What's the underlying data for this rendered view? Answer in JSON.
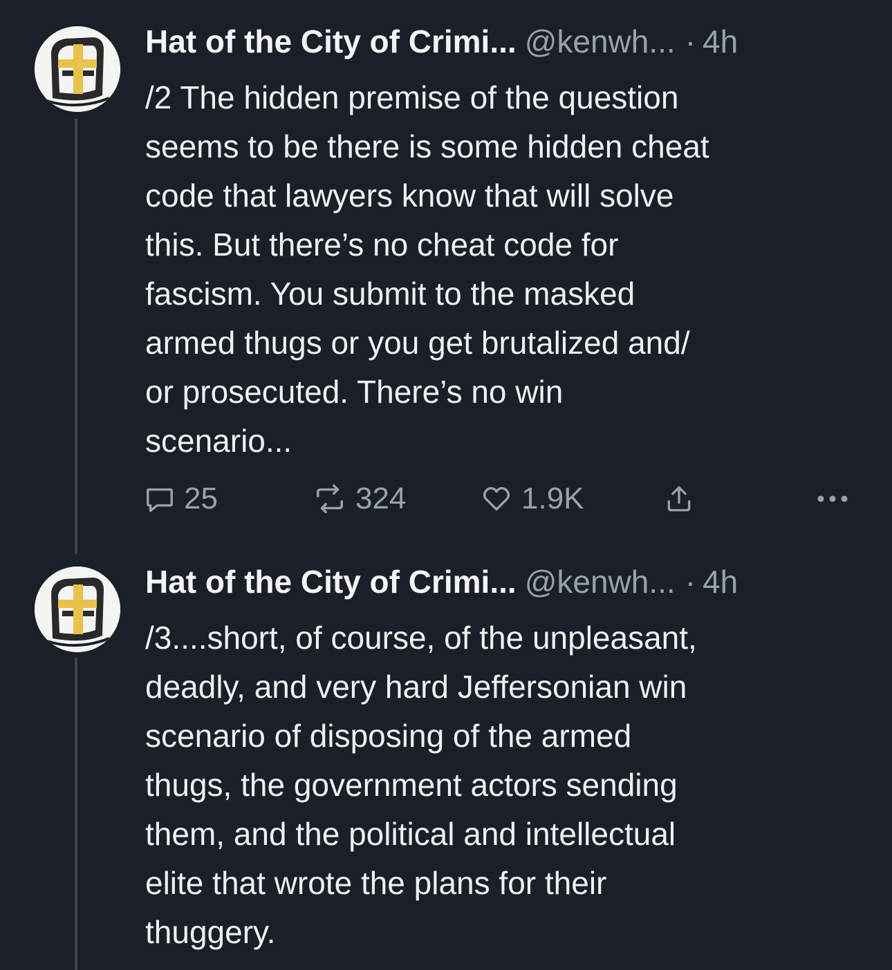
{
  "tweets": [
    {
      "author_name": "Hat of the City of Crimi...",
      "handle": "@kenwh...",
      "separator": "·",
      "time": "4h",
      "avatar_icon": "crusader-helmet-icon",
      "text_lines": [
        "/2 The hidden premise of the question",
        "seems to be there is some hidden cheat",
        "code that lawyers know that will solve",
        "this.  But there’s no cheat code for",
        "fascism.  You submit to the masked",
        "armed thugs or you get brutalized and/",
        "or prosecuted. There’s no win",
        "scenario..."
      ],
      "replies": "25",
      "reposts": "324",
      "likes": "1.9K"
    },
    {
      "author_name": "Hat of the City of Crimi...",
      "handle": "@kenwh...",
      "separator": "·",
      "time": "4h",
      "avatar_icon": "crusader-helmet-icon",
      "text_lines": [
        "/3....short, of course, of the unpleasant,",
        "deadly, and very hard Jeffersonian win",
        "scenario of disposing of the armed",
        "thugs, the government actors sending",
        "them, and the political and intellectual",
        "elite that wrote the plans for their",
        "thuggery."
      ]
    }
  ],
  "icons": {
    "reply": "reply-bubble-icon",
    "repost": "repost-arrows-icon",
    "like": "heart-icon",
    "share": "share-upload-icon",
    "more": "more-dots-icon"
  },
  "colors": {
    "background": "#1b1f27",
    "text": "#eef0f2",
    "muted": "#98a1ad",
    "thread_line": "#3d4552",
    "avatar_gold": "#e8c24a"
  }
}
